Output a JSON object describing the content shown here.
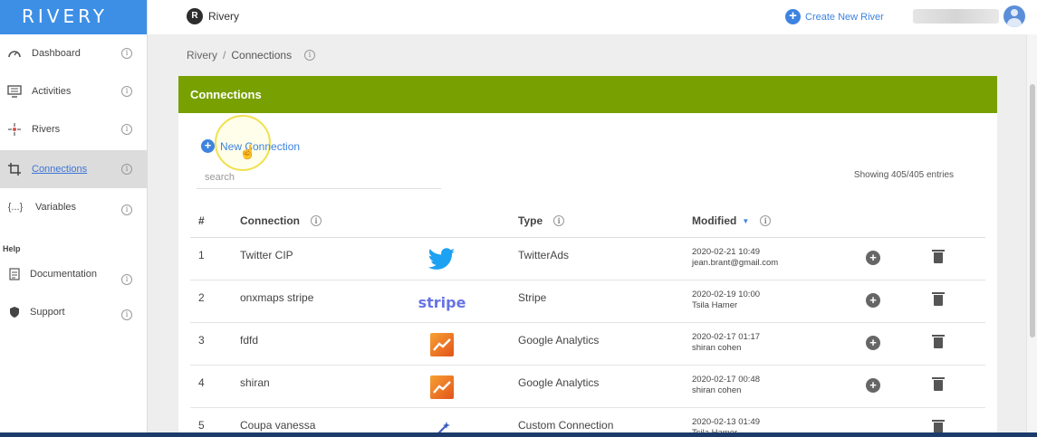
{
  "app": {
    "logo": "RIVERY",
    "workspace_initial": "R",
    "workspace_name": "Rivery"
  },
  "topbar": {
    "create_river": "Create New River"
  },
  "sidebar": {
    "items": [
      {
        "label": "Dashboard",
        "icon": "speedometer-icon"
      },
      {
        "label": "Activities",
        "icon": "monitor-icon"
      },
      {
        "label": "Rivers",
        "icon": "rivers-icon"
      },
      {
        "label": "Connections",
        "icon": "crop-icon",
        "active": true
      },
      {
        "label": "Variables",
        "icon": "braces-icon"
      }
    ],
    "help_heading": "Help",
    "help_items": [
      {
        "label": "Documentation",
        "icon": "document-icon"
      },
      {
        "label": "Support",
        "icon": "shield-icon"
      }
    ]
  },
  "breadcrumb": {
    "root": "Rivery",
    "separator": "/",
    "current": "Connections"
  },
  "card": {
    "title": "Connections",
    "new_connection": "New Connection",
    "search_placeholder": "search",
    "entries": "Showing 405/405 entries"
  },
  "table": {
    "headers": {
      "num": "#",
      "connection": "Connection",
      "type": "Type",
      "modified": "Modified"
    },
    "rows": [
      {
        "num": "1",
        "name": "Twitter CIP",
        "logo": "twitter",
        "type": "TwitterAds",
        "date": "2020-02-21 10:49",
        "user": "jean.brant@gmail.com"
      },
      {
        "num": "2",
        "name": "onxmaps stripe",
        "logo": "stripe",
        "type": "Stripe",
        "date": "2020-02-19 10:00",
        "user": "Tsila Hamer"
      },
      {
        "num": "3",
        "name": "fdfd",
        "logo": "google-analytics",
        "type": "Google Analytics",
        "date": "2020-02-17 01:17",
        "user": "shiran cohen"
      },
      {
        "num": "4",
        "name": "shiran",
        "logo": "google-analytics",
        "type": "Google Analytics",
        "date": "2020-02-17 00:48",
        "user": "shiran cohen"
      },
      {
        "num": "5",
        "name": "Coupa vanessa",
        "logo": "custom-connection",
        "type": "Custom Connection",
        "date": "2020-02-13 01:49",
        "user": "Tsila Hamer"
      }
    ],
    "stripe_logo_text": "stripe"
  },
  "colors": {
    "accent": "#3d83e0",
    "header_green": "#77a000",
    "logo_blue": "#3d8fe6"
  }
}
